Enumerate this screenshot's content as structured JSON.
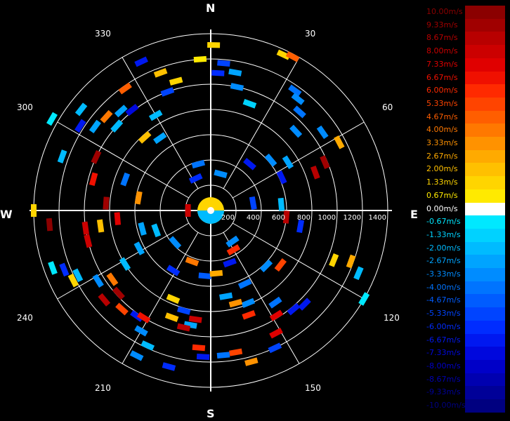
{
  "chart_data": {
    "type": "polar-radial-velocity",
    "directions": [
      "N",
      "E",
      "S",
      "W"
    ],
    "bearing_labels": [
      "30",
      "60",
      "120",
      "150",
      "210",
      "240",
      "300",
      "330"
    ],
    "range_labels": [
      "200",
      "400",
      "600",
      "800",
      "1000",
      "1200",
      "1400"
    ],
    "range_max": 1400,
    "legend": {
      "unit": "m/s",
      "entries": [
        {
          "label": "10.00m/s",
          "color": "#8b0000"
        },
        {
          "label": "9.33m/s",
          "color": "#a00000"
        },
        {
          "label": "8.67m/s",
          "color": "#b80000"
        },
        {
          "label": "8.00m/s",
          "color": "#cc0000"
        },
        {
          "label": "7.33m/s",
          "color": "#e00000"
        },
        {
          "label": "6.67m/s",
          "color": "#f01000"
        },
        {
          "label": "6.00m/s",
          "color": "#ff2a00"
        },
        {
          "label": "5.33m/s",
          "color": "#ff4400"
        },
        {
          "label": "4.67m/s",
          "color": "#ff5e00"
        },
        {
          "label": "4.00m/s",
          "color": "#ff7800"
        },
        {
          "label": "3.33m/s",
          "color": "#ff9200"
        },
        {
          "label": "2.67m/s",
          "color": "#ffaa00"
        },
        {
          "label": "2.00m/s",
          "color": "#ffc000"
        },
        {
          "label": "1.33m/s",
          "color": "#ffd500"
        },
        {
          "label": "0.67m/s",
          "color": "#ffea00"
        },
        {
          "label": "0.00m/s",
          "color": "#ffffff"
        },
        {
          "label": "-0.67m/s",
          "color": "#00e8ff"
        },
        {
          "label": "-1.33m/s",
          "color": "#00d2ff"
        },
        {
          "label": "-2.00m/s",
          "color": "#00bbff"
        },
        {
          "label": "-2.67m/s",
          "color": "#00a4ff"
        },
        {
          "label": "-3.33m/s",
          "color": "#008cff"
        },
        {
          "label": "-4.00m/s",
          "color": "#0074ff"
        },
        {
          "label": "-4.67m/s",
          "color": "#005cff"
        },
        {
          "label": "-5.33m/s",
          "color": "#0044ff"
        },
        {
          "label": "-6.00m/s",
          "color": "#002cff"
        },
        {
          "label": "-6.67m/s",
          "color": "#0018f0"
        },
        {
          "label": "-7.33m/s",
          "color": "#0008dd"
        },
        {
          "label": "-8.00m/s",
          "color": "#0000c8"
        },
        {
          "label": "-8.67m/s",
          "color": "#0000b0"
        },
        {
          "label": "-9.33m/s",
          "color": "#000098"
        },
        {
          "label": "-10.00m/s",
          "color": "#000080"
        }
      ]
    },
    "echoes": [
      {
        "az": 1,
        "r": 1310,
        "v": 1.3
      },
      {
        "az": 356,
        "r": 1200,
        "v": 0.7
      },
      {
        "az": 5,
        "r": 1170,
        "v": -5.2
      },
      {
        "az": 3,
        "r": 1090,
        "v": -6.0
      },
      {
        "az": 10,
        "r": 1110,
        "v": -2.6
      },
      {
        "az": 12,
        "r": 1000,
        "v": -3.3
      },
      {
        "az": 20,
        "r": 900,
        "v": -1.3
      },
      {
        "az": 25,
        "r": 1360,
        "v": 1.3
      },
      {
        "az": 28,
        "r": 1380,
        "v": 4.7
      },
      {
        "az": 35,
        "r": 1160,
        "v": -4.0
      },
      {
        "az": 38,
        "r": 1120,
        "v": -3.3
      },
      {
        "az": 42,
        "r": 1050,
        "v": -4.0
      },
      {
        "az": 47,
        "r": 920,
        "v": -3.3
      },
      {
        "az": 55,
        "r": 1080,
        "v": -3.3
      },
      {
        "az": 58,
        "r": 720,
        "v": -2.6
      },
      {
        "az": 62,
        "r": 1150,
        "v": 2.7
      },
      {
        "az": 67,
        "r": 980,
        "v": 9.3
      },
      {
        "az": 70,
        "r": 880,
        "v": 8.7
      },
      {
        "az": 65,
        "r": 620,
        "v": -6.7
      },
      {
        "az": 50,
        "r": 620,
        "v": -3.3
      },
      {
        "az": 300,
        "r": 1450,
        "v": -0.7
      },
      {
        "az": 308,
        "r": 1300,
        "v": -2.0
      },
      {
        "az": 303,
        "r": 1230,
        "v": -6.7
      },
      {
        "az": 306,
        "r": 1130,
        "v": -2.6
      },
      {
        "az": 312,
        "r": 1110,
        "v": 4.0
      },
      {
        "az": 318,
        "r": 1060,
        "v": -2.6
      },
      {
        "az": 312,
        "r": 1000,
        "v": -2.0
      },
      {
        "az": 322,
        "r": 1010,
        "v": -7.3
      },
      {
        "az": 325,
        "r": 1180,
        "v": 4.7
      },
      {
        "az": 335,
        "r": 1300,
        "v": -6.7
      },
      {
        "az": 340,
        "r": 1160,
        "v": 2.0
      },
      {
        "az": 345,
        "r": 1060,
        "v": 1.3
      },
      {
        "az": 340,
        "r": 1000,
        "v": -5.3
      },
      {
        "az": 330,
        "r": 870,
        "v": -2.0
      },
      {
        "az": 318,
        "r": 780,
        "v": 2.0
      },
      {
        "az": 295,
        "r": 1000,
        "v": 9.3
      },
      {
        "az": 325,
        "r": 700,
        "v": -2.6
      },
      {
        "az": 270,
        "r": 1400,
        "v": 1.3
      },
      {
        "az": 265,
        "r": 1280,
        "v": 10.0
      },
      {
        "az": 262,
        "r": 1000,
        "v": 8.0
      },
      {
        "az": 256,
        "r": 1000,
        "v": 8.0
      },
      {
        "az": 262,
        "r": 880,
        "v": 2.0
      },
      {
        "az": 250,
        "r": 1330,
        "v": -0.7
      },
      {
        "az": 248,
        "r": 1250,
        "v": -6.0
      },
      {
        "az": 243,
        "r": 1220,
        "v": 1.3
      },
      {
        "az": 244,
        "r": 1170,
        "v": -2.0
      },
      {
        "az": 238,
        "r": 1050,
        "v": -3.3
      },
      {
        "az": 235,
        "r": 950,
        "v": 4.0
      },
      {
        "az": 238,
        "r": 800,
        "v": -2.0
      },
      {
        "az": 242,
        "r": 640,
        "v": -2.6
      },
      {
        "az": 230,
        "r": 1100,
        "v": 8.7
      },
      {
        "az": 222,
        "r": 1050,
        "v": 5.3
      },
      {
        "az": 228,
        "r": 980,
        "v": 9.3
      },
      {
        "az": 215,
        "r": 1020,
        "v": -6.7
      },
      {
        "az": 212,
        "r": 1000,
        "v": 6.7
      },
      {
        "az": 205,
        "r": 1180,
        "v": -2.0
      },
      {
        "az": 210,
        "r": 1100,
        "v": -3.3
      },
      {
        "az": 207,
        "r": 1290,
        "v": -3.3
      },
      {
        "az": 195,
        "r": 1280,
        "v": -6.0
      },
      {
        "az": 200,
        "r": 900,
        "v": 2.0
      },
      {
        "az": 203,
        "r": 760,
        "v": 1.3
      },
      {
        "az": 195,
        "r": 820,
        "v": -5.3
      },
      {
        "az": 190,
        "r": 920,
        "v": -2.6
      },
      {
        "az": 188,
        "r": 870,
        "v": 8.0
      },
      {
        "az": 193,
        "r": 950,
        "v": 8.7
      },
      {
        "az": 185,
        "r": 1090,
        "v": 6.0
      },
      {
        "az": 183,
        "r": 1160,
        "v": -6.7
      },
      {
        "az": 175,
        "r": 1150,
        "v": -4.0
      },
      {
        "az": 170,
        "r": 1140,
        "v": 5.3
      },
      {
        "az": 165,
        "r": 1240,
        "v": 3.3
      },
      {
        "az": 155,
        "r": 1200,
        "v": -5.3
      },
      {
        "az": 152,
        "r": 1100,
        "v": 7.3
      },
      {
        "az": 148,
        "r": 980,
        "v": 7.3
      },
      {
        "az": 145,
        "r": 890,
        "v": -4.0
      },
      {
        "az": 160,
        "r": 880,
        "v": 6.0
      },
      {
        "az": 158,
        "r": 790,
        "v": -3.3
      },
      {
        "az": 165,
        "r": 760,
        "v": 3.3
      },
      {
        "az": 170,
        "r": 690,
        "v": -2.6
      },
      {
        "az": 155,
        "r": 640,
        "v": -4.0
      },
      {
        "az": 140,
        "r": 1020,
        "v": -6.7
      },
      {
        "az": 135,
        "r": 1050,
        "v": -6.7
      },
      {
        "az": 120,
        "r": 1400,
        "v": -0.7
      },
      {
        "az": 113,
        "r": 1270,
        "v": -2.0
      },
      {
        "az": 110,
        "r": 1180,
        "v": 2.7
      },
      {
        "az": 112,
        "r": 1050,
        "v": 1.3
      },
      {
        "az": 135,
        "r": 620,
        "v": -3.3
      },
      {
        "az": 128,
        "r": 700,
        "v": 5.3
      },
      {
        "az": 100,
        "r": 720,
        "v": -6.0
      },
      {
        "az": 95,
        "r": 600,
        "v": 8.7
      },
      {
        "az": 85,
        "r": 560,
        "v": -2.0
      },
      {
        "az": 80,
        "r": 340,
        "v": -5.3
      },
      {
        "az": 40,
        "r": 480,
        "v": -6.7
      },
      {
        "az": 15,
        "r": 300,
        "v": -3.3
      },
      {
        "az": 345,
        "r": 380,
        "v": -4.0
      },
      {
        "az": 335,
        "r": 280,
        "v": -6.0
      },
      {
        "az": 270,
        "r": 180,
        "v": 8.0
      },
      {
        "az": 280,
        "r": 580,
        "v": 3.3
      },
      {
        "az": 290,
        "r": 720,
        "v": -4.0
      },
      {
        "az": 255,
        "r": 560,
        "v": -2.6
      },
      {
        "az": 250,
        "r": 460,
        "v": -2.0
      },
      {
        "az": 228,
        "r": 380,
        "v": -3.3
      },
      {
        "az": 212,
        "r": 560,
        "v": -6.0
      },
      {
        "az": 200,
        "r": 430,
        "v": 4.0
      },
      {
        "az": 185,
        "r": 520,
        "v": -4.6
      },
      {
        "az": 175,
        "r": 500,
        "v": 2.7
      },
      {
        "az": 160,
        "r": 440,
        "v": -6.7
      },
      {
        "az": 150,
        "r": 360,
        "v": 6.0
      },
      {
        "az": 145,
        "r": 300,
        "v": -3.3
      },
      {
        "az": 265,
        "r": 740,
        "v": 7.3
      },
      {
        "az": 274,
        "r": 830,
        "v": 9.3
      },
      {
        "az": 285,
        "r": 960,
        "v": 6.7
      },
      {
        "az": 290,
        "r": 1250,
        "v": -2.0
      }
    ]
  }
}
